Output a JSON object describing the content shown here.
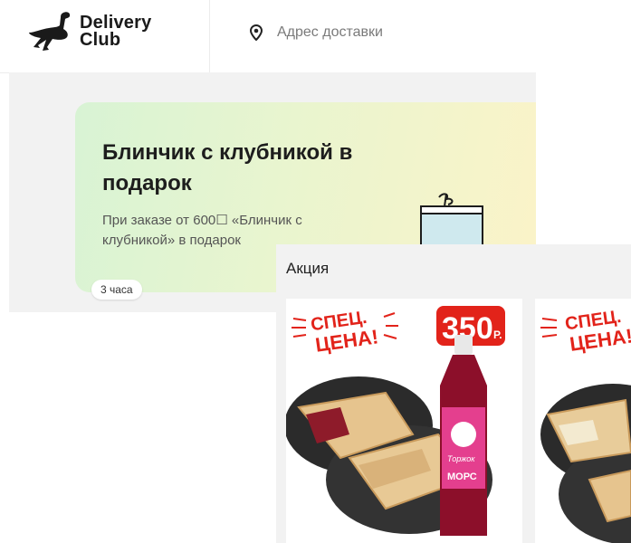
{
  "header": {
    "logo_line1": "Delivery",
    "logo_line2": "Club",
    "address_placeholder": "Адрес доставки"
  },
  "promo": {
    "title": "Блинчик с клубникой в подарок",
    "description": "При заказе от 600☐ «Блинчик с клубникой» в подарок",
    "time_badge": "3 часа"
  },
  "overlay": {
    "title": "Акция",
    "products": [
      {
        "badge_line1": "СПЕЦ.",
        "badge_line2": "ЦЕНА!",
        "price": "350",
        "currency": "Р.",
        "drink_label": "МОРС",
        "brand": "Торжок"
      },
      {
        "badge_line1": "СПЕЦ.",
        "badge_line2": "ЦЕНА!"
      }
    ]
  },
  "colors": {
    "badge_red": "#e2231a",
    "brand_dark": "#1a1a1a",
    "drink_red": "#8c0f2a"
  },
  "icons": [
    "ostrich-logo-icon",
    "location-pin-icon",
    "gift-icon"
  ]
}
